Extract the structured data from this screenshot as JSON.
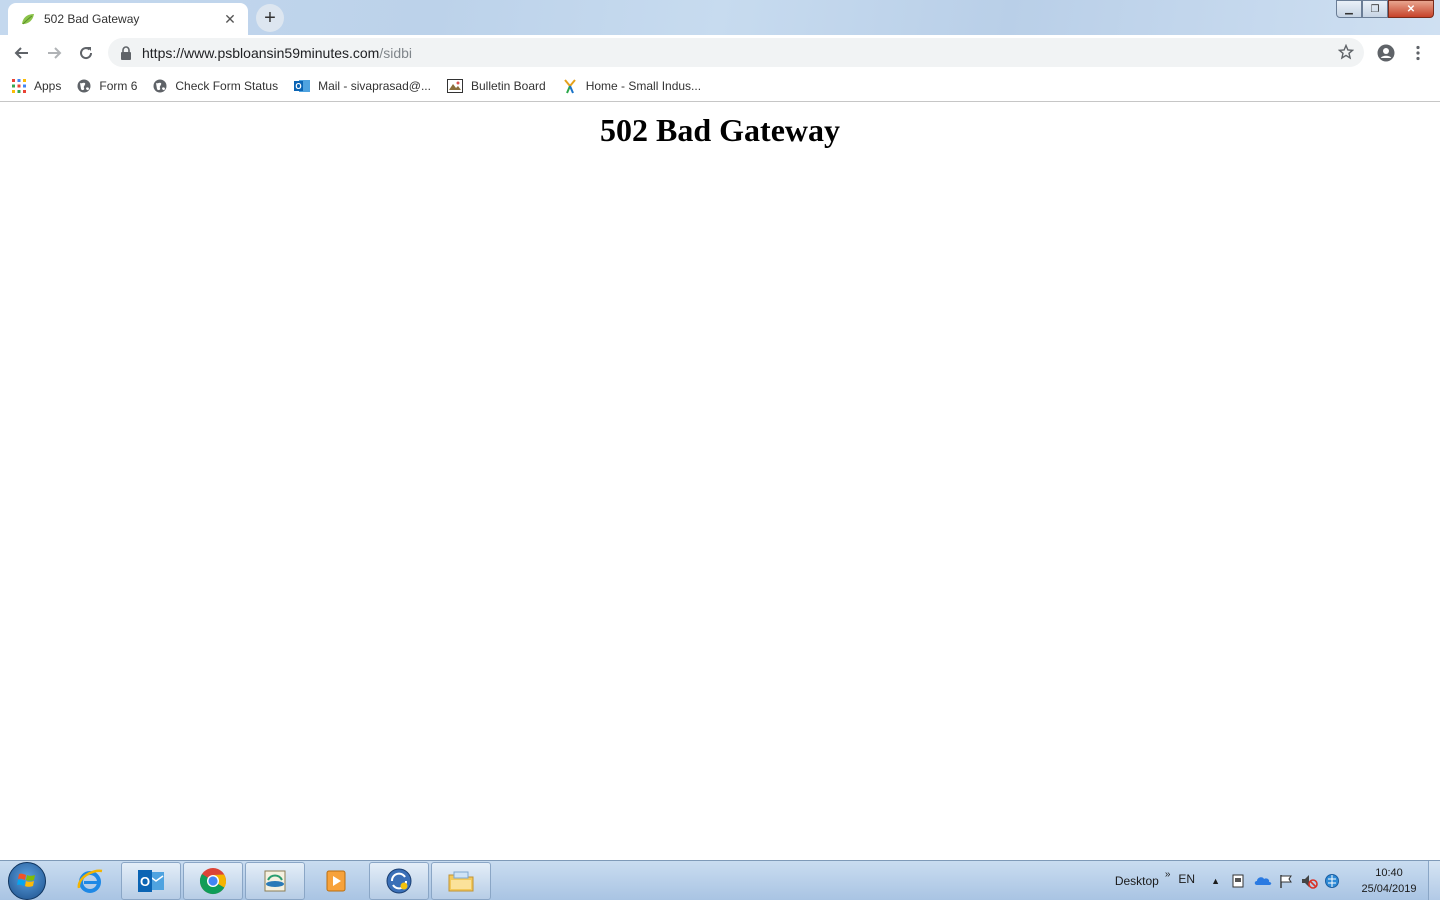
{
  "browser": {
    "tab": {
      "title": "502 Bad Gateway"
    },
    "url": {
      "host": "https://www.psbloansin59minutes.com",
      "path": "/sidbi"
    },
    "bookmarks": [
      {
        "label": "Apps",
        "icon": "apps-grid-icon"
      },
      {
        "label": "Form 6",
        "icon": "globe-icon"
      },
      {
        "label": "Check Form Status",
        "icon": "globe-icon"
      },
      {
        "label": "Mail - sivaprasad@...",
        "icon": "outlook-icon"
      },
      {
        "label": "Bulletin Board",
        "icon": "bulletin-icon"
      },
      {
        "label": "Home - Small Indus...",
        "icon": "sidbi-icon"
      }
    ]
  },
  "page": {
    "heading": "502 Bad Gateway"
  },
  "taskbar": {
    "apps": [
      "internet-explorer-icon",
      "outlook-icon",
      "chrome-icon",
      "network-app-icon",
      "media-player-icon",
      "sync-app-icon",
      "file-explorer-icon"
    ],
    "desktop_label": "Desktop",
    "language": "EN",
    "time": "10:40",
    "date": "25/04/2019"
  },
  "colors": {
    "tab_favicon": "#8bc34a",
    "taskbar_bg": "#b9d1ec"
  }
}
